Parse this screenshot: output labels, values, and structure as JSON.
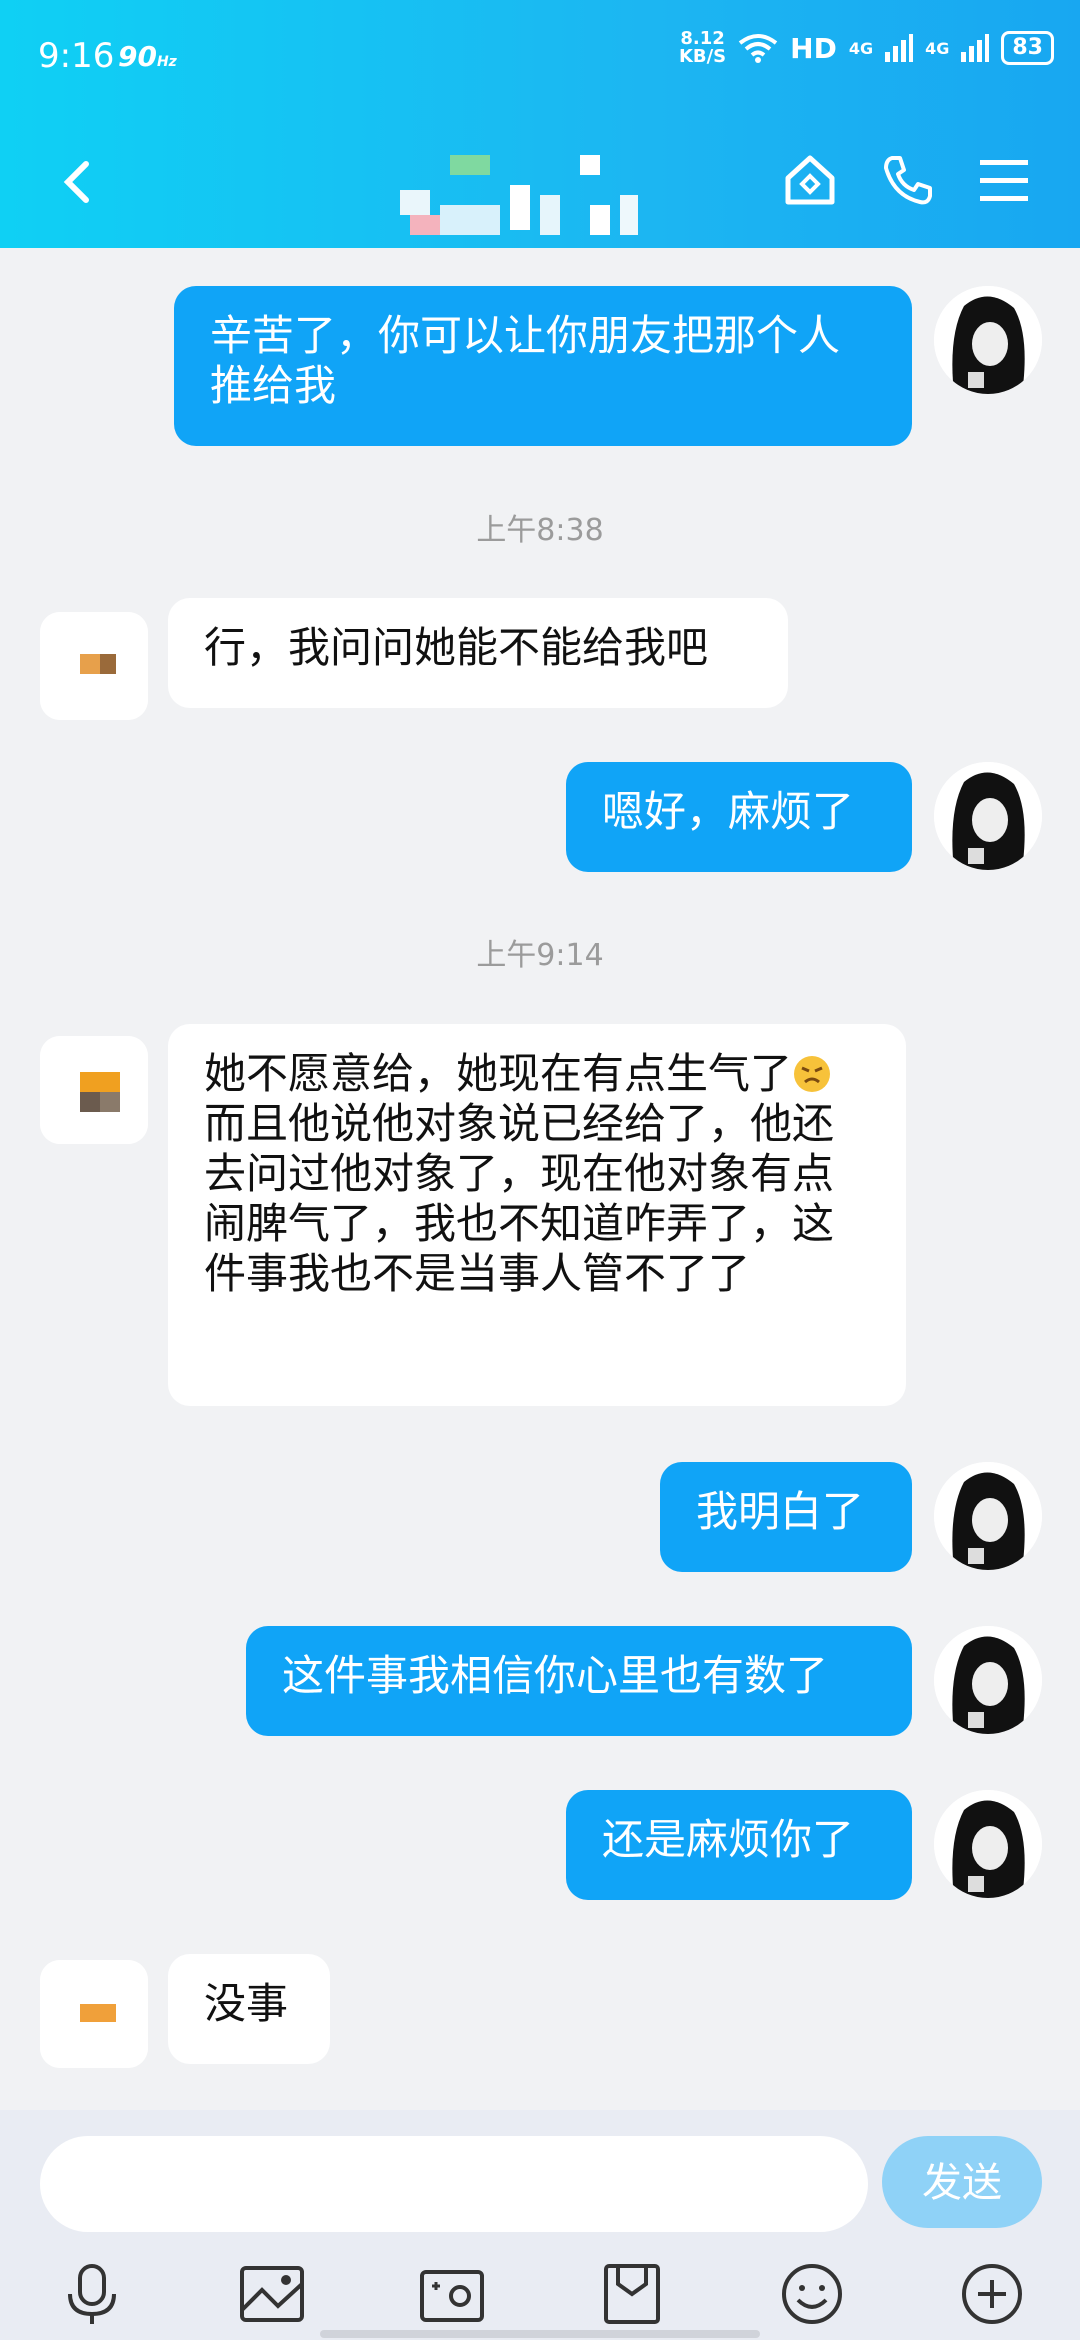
{
  "status": {
    "time": "9:16",
    "refresh": "90",
    "refresh_unit": "Hz",
    "speed_top": "8.12",
    "speed_unit": "KB/S",
    "hd": "HD",
    "net1": "4G",
    "net2": "4G",
    "battery": "83"
  },
  "icons": {
    "back": "back-arrow-icon",
    "home": "house-icon",
    "call": "phone-icon",
    "menu": "menu-icon",
    "mic": "microphone-icon",
    "image": "image-icon",
    "camera": "camera-icon",
    "file": "file-icon",
    "emoji": "emoji-icon",
    "plus": "plus-icon",
    "inline_emoji": "angry-face-icon"
  },
  "colors": {
    "header": "#18b4f2",
    "my_bubble": "#10a4f7",
    "other_bubble": "#ffffff",
    "send_button": "#8fd2f7"
  },
  "messages": [
    {
      "from": "me",
      "text": "辛苦了，你可以让你朋友把那个人推给我"
    },
    {
      "type": "time",
      "text": "上午8:38"
    },
    {
      "from": "other",
      "text": "行，我问问她能不能给我吧"
    },
    {
      "from": "me",
      "text": "嗯好，麻烦了"
    },
    {
      "type": "time",
      "text": "上午9:14"
    },
    {
      "from": "other",
      "text_a": "她不愿意给，她现在有点生气了",
      "text_b": "而且他说他对象说已经给了，他还去问过他对象了，现在他对象有点闹脾气了，我也不知道咋弄了，这件事我也不是当事人管不了了"
    },
    {
      "from": "me",
      "text": "我明白了"
    },
    {
      "from": "me",
      "text": "这件事我相信你心里也有数了"
    },
    {
      "from": "me",
      "text": "还是麻烦你了"
    },
    {
      "from": "other",
      "text": "没事"
    }
  ],
  "composer": {
    "placeholder": "",
    "send_label": "发送"
  }
}
